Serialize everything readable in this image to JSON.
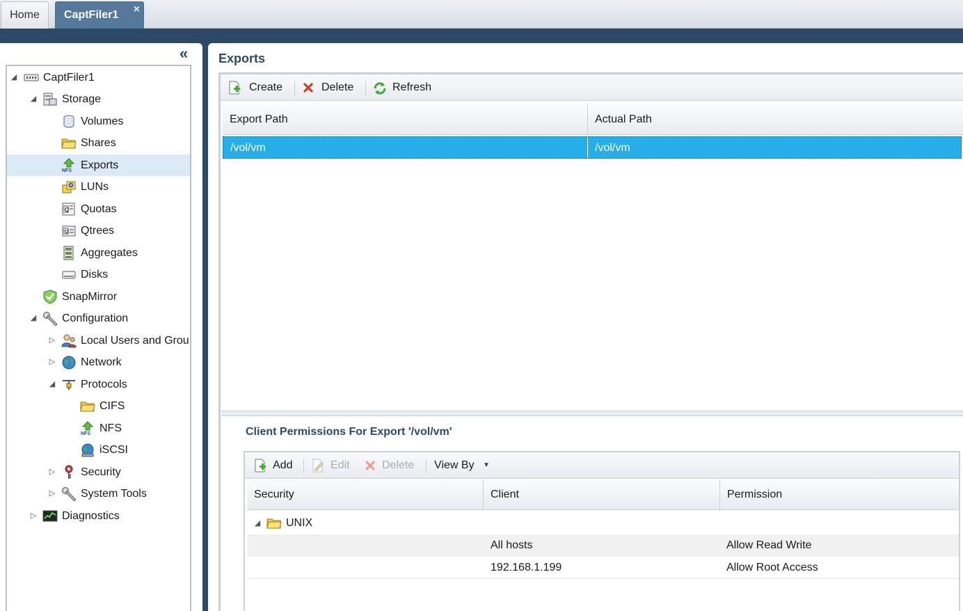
{
  "tabs": {
    "home": "Home",
    "active": "CaptFiler1",
    "close": "×"
  },
  "sidebar": {
    "collapse": "«",
    "tree": [
      {
        "label": "CaptFiler1",
        "icon": "filer-icon",
        "twisty": "expanded"
      },
      {
        "label": "Storage",
        "icon": "storage-icon",
        "twisty": "expanded"
      },
      {
        "label": "Volumes",
        "icon": "volume-icon"
      },
      {
        "label": "Shares",
        "icon": "folder-share-icon"
      },
      {
        "label": "Exports",
        "icon": "nfs-export-icon",
        "selected": true
      },
      {
        "label": "LUNs",
        "icon": "lun-icon"
      },
      {
        "label": "Quotas",
        "icon": "quota-icon"
      },
      {
        "label": "Qtrees",
        "icon": "qtree-icon"
      },
      {
        "label": "Aggregates",
        "icon": "aggregate-icon"
      },
      {
        "label": "Disks",
        "icon": "disk-icon"
      },
      {
        "label": "SnapMirror",
        "icon": "shield-check-icon"
      },
      {
        "label": "Configuration",
        "icon": "wrench-icon",
        "twisty": "expanded"
      },
      {
        "label": "Local Users and Grou",
        "icon": "users-icon",
        "twisty": "collapsed"
      },
      {
        "label": "Network",
        "icon": "globe-icon",
        "twisty": "collapsed"
      },
      {
        "label": "Protocols",
        "icon": "protocols-icon",
        "twisty": "expanded"
      },
      {
        "label": "CIFS",
        "icon": "folder-share-icon"
      },
      {
        "label": "NFS",
        "icon": "nfs-export-icon"
      },
      {
        "label": "iSCSI",
        "icon": "globe-icon"
      },
      {
        "label": "Security",
        "icon": "key-icon",
        "twisty": "collapsed"
      },
      {
        "label": "System Tools",
        "icon": "wrench-icon",
        "twisty": "collapsed"
      },
      {
        "label": "Diagnostics",
        "icon": "monitor-chart-icon",
        "twisty": "collapsed"
      }
    ]
  },
  "main": {
    "title": "Exports",
    "toolbar": {
      "create": "Create",
      "delete": "Delete",
      "refresh": "Refresh"
    },
    "grid": {
      "columns": [
        "Export Path",
        "Actual Path"
      ],
      "rows": [
        [
          "/vol/vm",
          "/vol/vm"
        ]
      ]
    },
    "permissions": {
      "title": "Client Permissions For Export '/vol/vm'",
      "toolbar": {
        "add": "Add",
        "edit": "Edit",
        "delete": "Delete",
        "view_by": "View By"
      },
      "columns": [
        "Security",
        "Client",
        "Permission"
      ],
      "group": "UNIX",
      "rows": [
        [
          "All hosts",
          "Allow Read Write"
        ],
        [
          "192.168.1.199",
          "Allow Root Access"
        ]
      ]
    }
  },
  "colors": {
    "accent": "#2c4a68",
    "selection": "#26aee8",
    "tree_selection": "#dce9f7"
  }
}
